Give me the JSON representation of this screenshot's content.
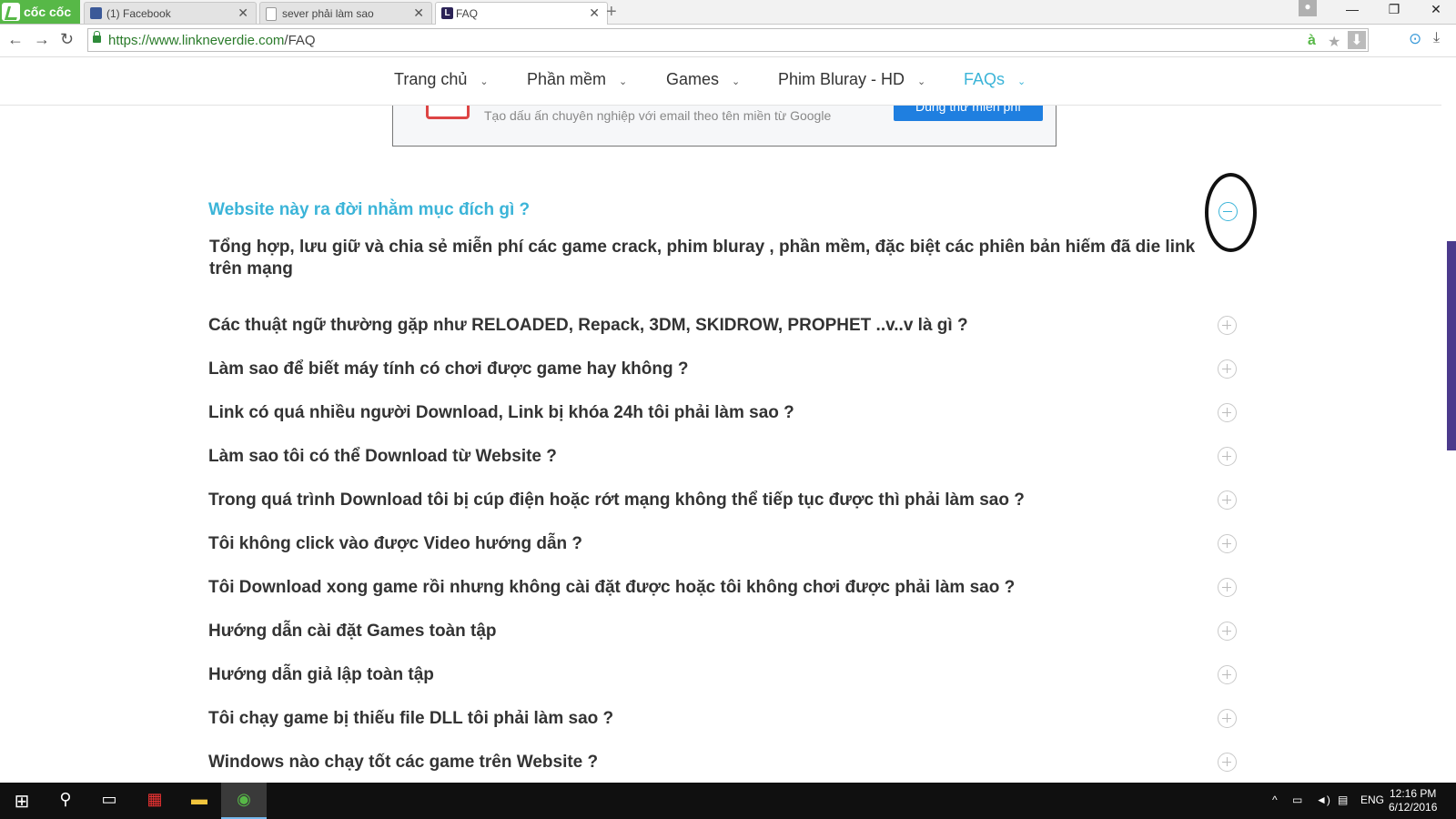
{
  "browser": {
    "brand": "cốc cốc",
    "tabs": [
      {
        "title": "(1) Facebook",
        "icon": "facebook-icon",
        "color": "#3b5998"
      },
      {
        "title": "sever phải làm sao",
        "icon": "page-icon",
        "color": "#cccccc"
      },
      {
        "title": "FAQ",
        "icon": "linkneverdie-icon",
        "color": "#2b2256"
      }
    ],
    "url_scheme": "https://",
    "url_host": "www.linkneverdie.com",
    "url_path": "/FAQ"
  },
  "nav": {
    "items": [
      "Trang chủ",
      "Phần mềm",
      "Games",
      "Phim Bluray - HD",
      "FAQs"
    ],
    "active": "FAQs",
    "accent": "#3bb4d8"
  },
  "ad": {
    "text": "Tạo dấu ấn chuyên nghiệp với email theo tên miền từ Google",
    "button": "Dùng thử miễn phí"
  },
  "faq": {
    "open_question": "Website này ra đời nhằm mục đích gì ?",
    "open_answer": "Tổng hợp, lưu giữ và chia sẻ miễn phí các game crack, phim bluray , phần mềm, đặc biệt các phiên bản hiếm đã die link trên mạng",
    "questions": [
      "Các thuật ngữ thường gặp như RELOADED, Repack, 3DM, SKIDROW, PROPHET ..v..v là gì ?",
      "Làm sao để biết máy tính có chơi được game hay không ?",
      "Link có quá nhiều người Download, Link bị khóa 24h tôi phải làm sao ?",
      "Làm sao tôi có thể Download từ Website ?",
      "Trong quá trình Download tôi bị cúp điện hoặc rớt mạng không thể tiếp tục được thì phải làm sao ?",
      "Tôi không click vào được Video hướng dẫn ?",
      "Tôi Download xong game rồi nhưng không cài đặt được hoặc tôi không chơi được phải làm sao ?",
      "Hướng dẫn cài đặt Games toàn tập",
      "Hướng dẫn giả lập toàn tập",
      "Tôi chạy game bị thiếu file DLL tôi phải làm sao ?",
      "Windows nào chạy tốt các game trên Website ?"
    ]
  },
  "taskbar": {
    "language": "ENG",
    "time": "12:16 PM",
    "date": "6/12/2016"
  }
}
